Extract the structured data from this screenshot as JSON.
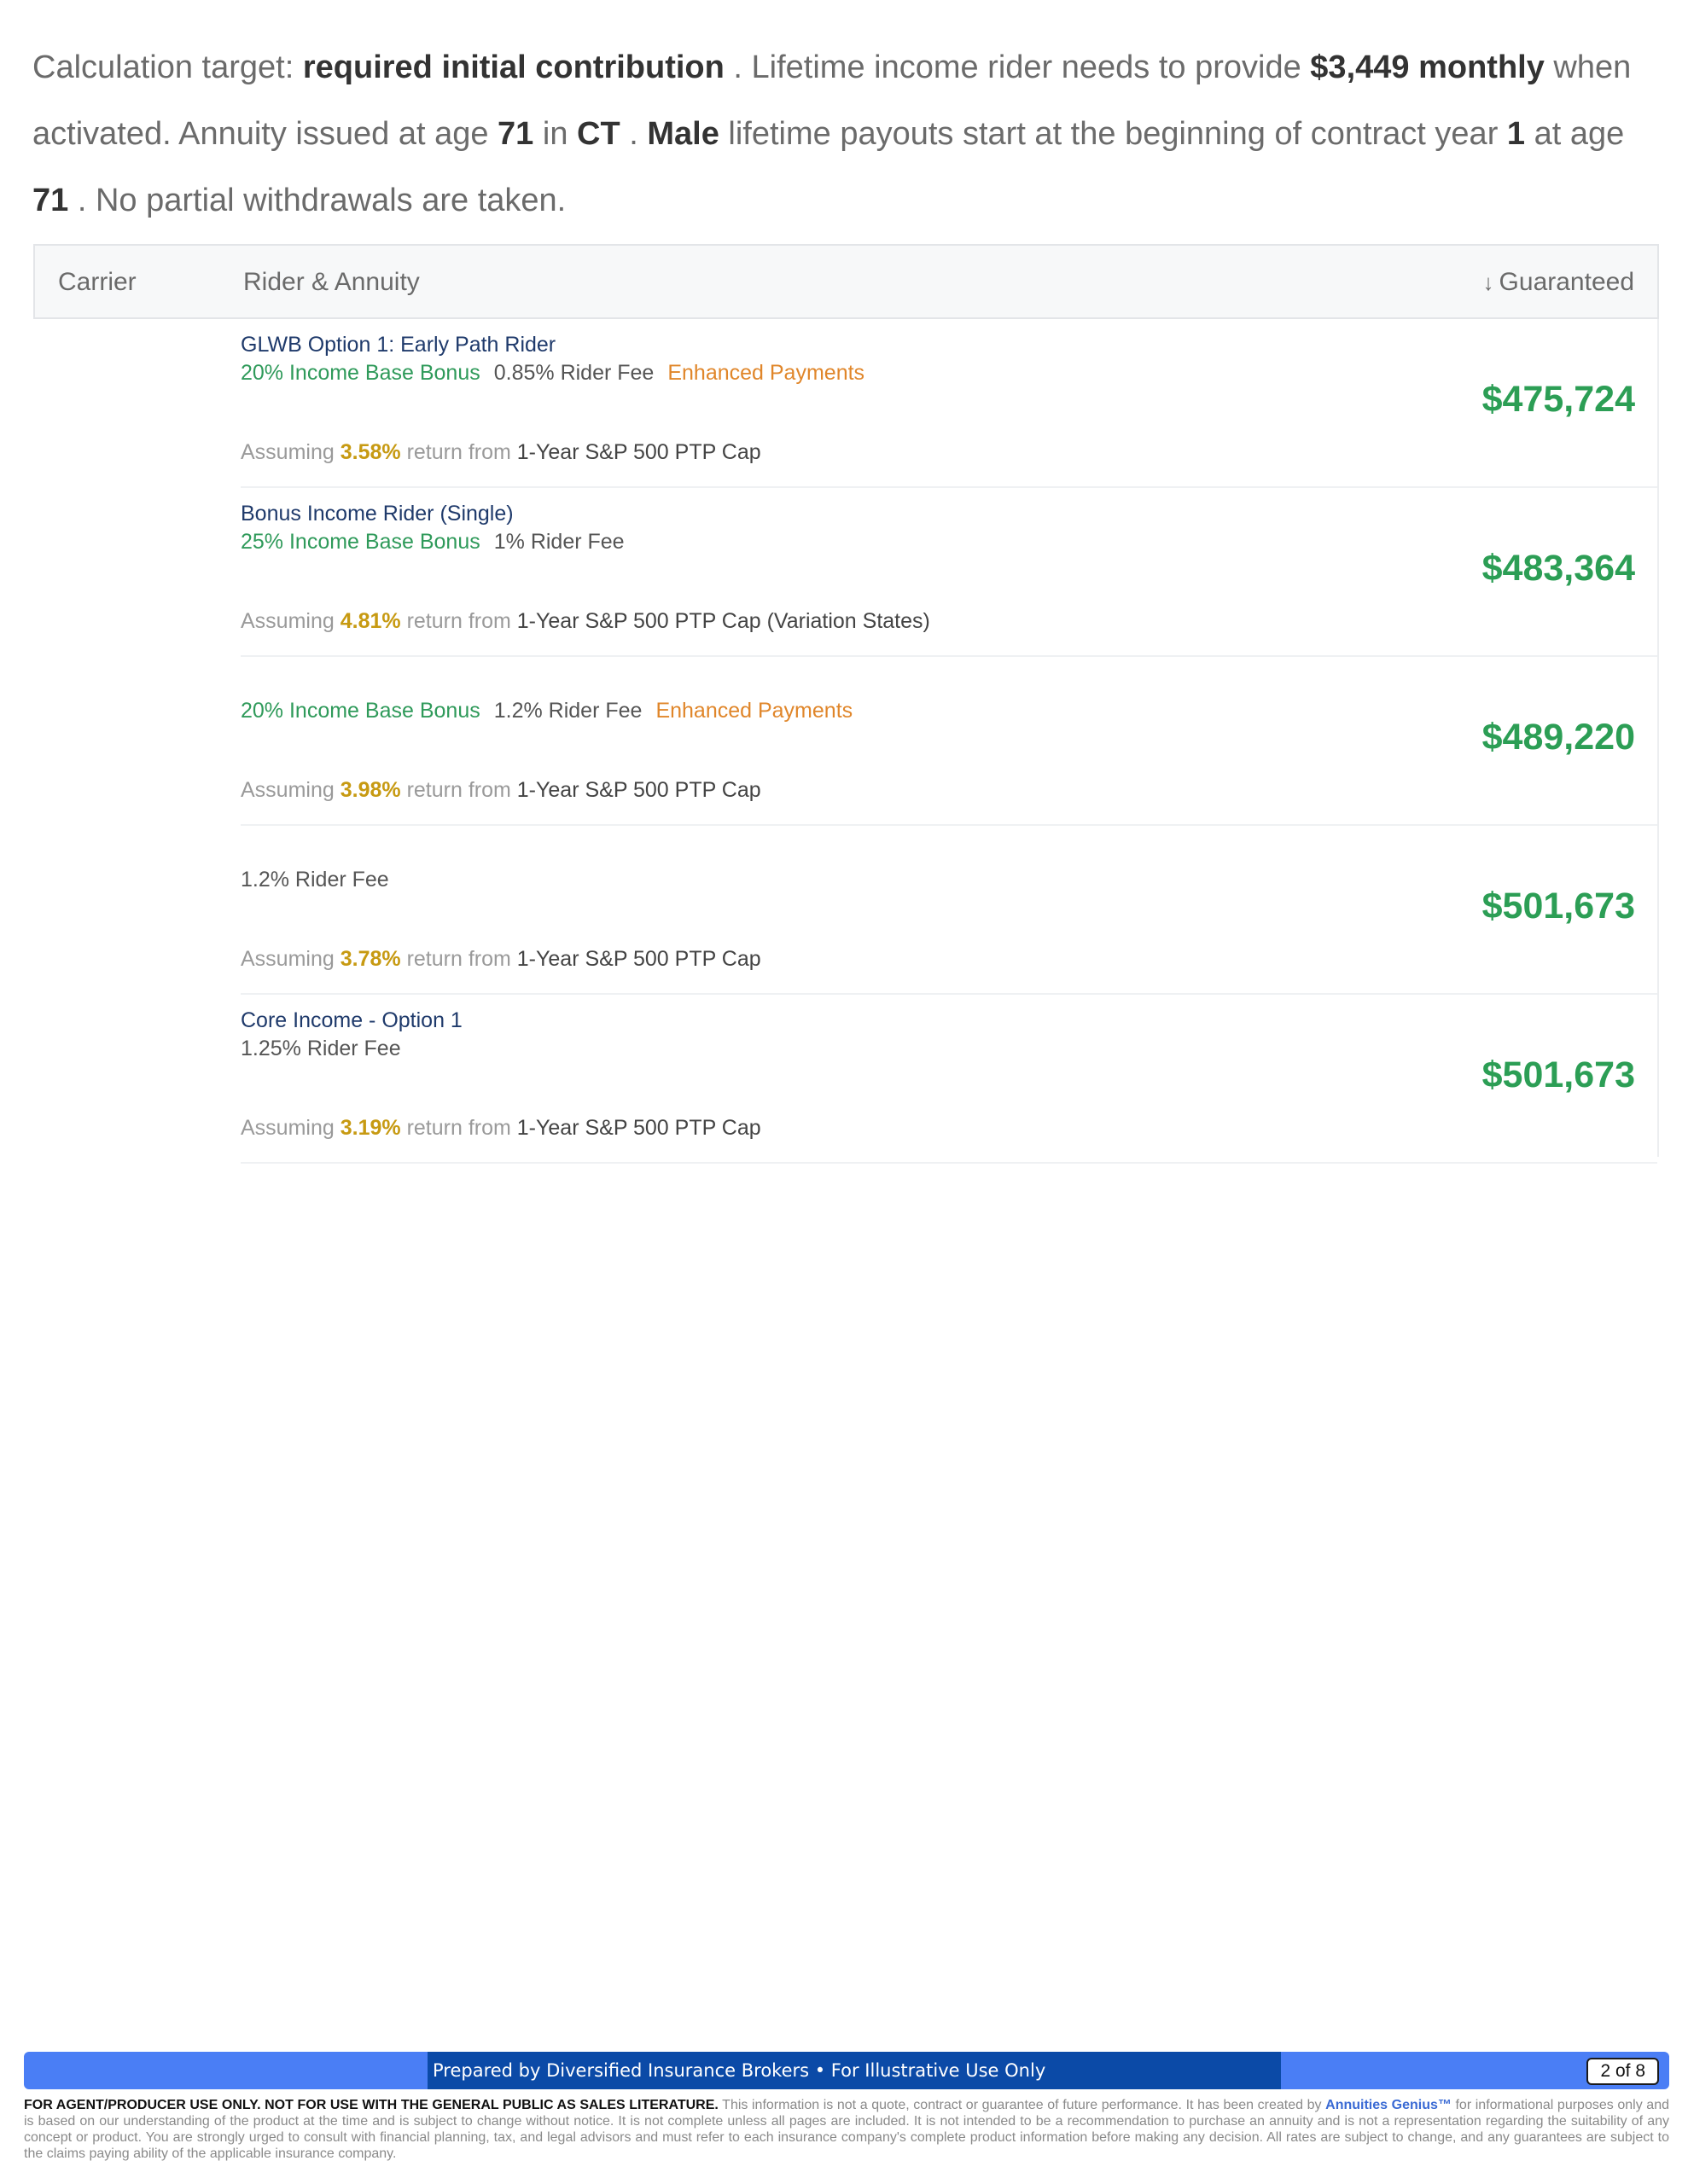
{
  "intro": {
    "p1": "Calculation target: ",
    "target": "required initial contribution",
    "p2": " . Lifetime income rider needs to provide ",
    "amount": "$3,449 monthly",
    "p3": " when activated. Annuity issued at age ",
    "issue_age": "71",
    "p4": " in ",
    "state": "CT",
    "p5": " . ",
    "gender": "Male",
    "p6": " lifetime payouts start at the beginning of contract year ",
    "contract_year": "1",
    "p7": " at age ",
    "payout_age": "71",
    "p8": " . No partial withdrawals are taken."
  },
  "table": {
    "headers": {
      "carrier": "Carrier",
      "rider": "Rider & Annuity",
      "guaranteed": "Guaranteed",
      "sort_icon": "↓"
    },
    "rows": [
      {
        "name": "GLWB Option 1: Early Path Rider",
        "bonus": "20% Income Base Bonus",
        "fee": "0.85% Rider Fee",
        "enhanced": "Enhanced Payments",
        "assuming": "Assuming",
        "rate": "3.58%",
        "return_from": "return from",
        "strategy": "1-Year S&P 500 PTP Cap",
        "amount": "$475,724"
      },
      {
        "name": "Bonus Income Rider (Single)",
        "bonus": "25% Income Base Bonus",
        "fee": "1% Rider Fee",
        "enhanced": "",
        "assuming": "Assuming",
        "rate": "4.81%",
        "return_from": "return from",
        "strategy": "1-Year S&P 500 PTP Cap (Variation States)",
        "amount": "$483,364"
      },
      {
        "name": "",
        "bonus": "20% Income Base Bonus",
        "fee": "1.2% Rider Fee",
        "enhanced": "Enhanced Payments",
        "assuming": "Assuming",
        "rate": "3.98%",
        "return_from": "return from",
        "strategy": "1-Year S&P 500 PTP Cap",
        "amount": "$489,220"
      },
      {
        "name": "",
        "bonus": "",
        "fee": "1.2% Rider Fee",
        "enhanced": "",
        "assuming": "Assuming",
        "rate": "3.78%",
        "return_from": "return from",
        "strategy": "1-Year S&P 500 PTP Cap",
        "amount": "$501,673"
      },
      {
        "name": "Core Income - Option 1",
        "bonus": "",
        "fee": "1.25% Rider Fee",
        "enhanced": "",
        "assuming": "Assuming",
        "rate": "3.19%",
        "return_from": "return from",
        "strategy": "1-Year S&P 500 PTP Cap",
        "amount": "$501,673"
      }
    ]
  },
  "footer": {
    "prepared": "Prepared by Diversified Insurance Brokers  •  For Illustrative Use Only",
    "page": "2 of 8"
  },
  "disclaimer": {
    "lead": "FOR AGENT/PRODUCER USE ONLY. NOT FOR USE WITH THE GENERAL PUBLIC AS SALES LITERATURE.",
    "body1": " This information is not a quote, contract or guarantee of future performance. It has been created by ",
    "brand": "Annuities Genius™",
    "body2": " for informational purposes only and is based on our understanding of the product at the time and is subject to change without notice. It is not complete unless all pages are included. It is not intended to be a recommendation to purchase an annuity and is not a representation regarding the suitability of any concept or product. You are strongly urged to consult with financial planning, tax, and legal advisors and must refer to each insurance company's complete product information before making any decision. All rates are subject to change, and any guarantees are subject to the claims paying ability of the applicable insurance company."
  },
  "colors": {
    "accent_green": "#2c9e55",
    "bonus_green": "#2f9a5a",
    "enhanced_orange": "#e0862a",
    "rate_gold": "#c79a12",
    "rider_name_navy": "#1f3a6b",
    "footer_blue": "#4a7ef5",
    "footer_dark_blue": "#0b4aa7"
  }
}
